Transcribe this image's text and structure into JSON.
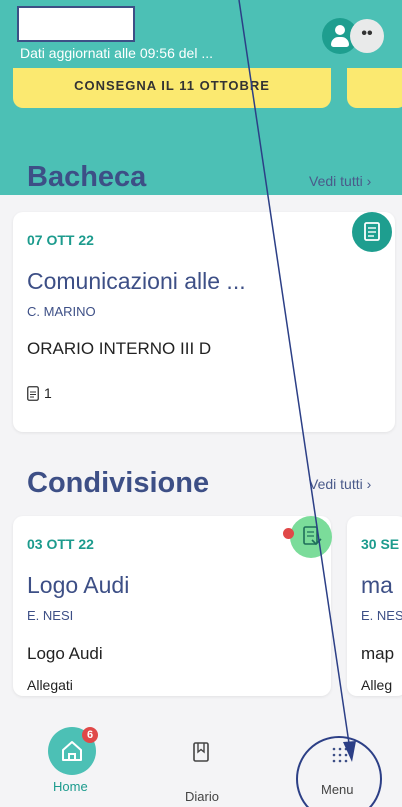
{
  "header": {
    "updated_text": "Dati aggiornati alle 09:56 del ...",
    "avatar_more": "••",
    "banner_text": "CONSEGNA IL 11 OTTOBRE"
  },
  "bacheca": {
    "title": "Bacheca",
    "see_all": "Vedi tutti ›",
    "card": {
      "date": "07 OTT 22",
      "title": "Comunicazioni alle ...",
      "author": "C. MARINO",
      "subject": "ORARIO INTERNO III D",
      "attachments": "1"
    }
  },
  "condivisione": {
    "title": "Condivisione",
    "see_all": "Vedi tutti ›",
    "cards": [
      {
        "date": "03 OTT 22",
        "title": "Logo Audi",
        "author": "E. NESI",
        "subject": "Logo Audi",
        "label": "Allegati"
      },
      {
        "date": "30 SE",
        "title": "ma",
        "author": "E. NES",
        "subject": "map",
        "label": "Alleg"
      }
    ]
  },
  "nav": {
    "home_label": "Home",
    "home_badge": "6",
    "diary_label": "Diario",
    "menu_label": "Menu"
  },
  "colors": {
    "teal": "#4cc0b5",
    "navy": "#3d4f86",
    "yellow": "#fbe970",
    "badge_red": "#e04848"
  }
}
